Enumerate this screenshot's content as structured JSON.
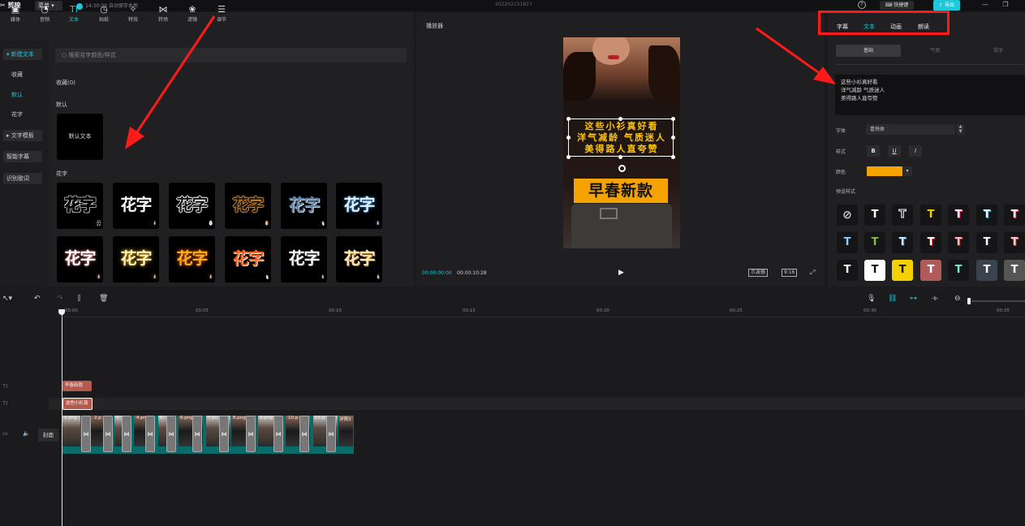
{
  "topbar": {
    "app_name": "剪映",
    "menu_label": "菜单",
    "save_status": "14:30:09 自动保存本地",
    "project_name": "202202151827",
    "shortcut_label": "快捷键",
    "export_label": "导出"
  },
  "tools": [
    {
      "label": "媒体",
      "icon": "media-icon"
    },
    {
      "label": "音频",
      "icon": "audio-icon"
    },
    {
      "label": "文本",
      "icon": "text-icon",
      "active": true
    },
    {
      "label": "贴纸",
      "icon": "sticker-icon"
    },
    {
      "label": "特效",
      "icon": "effects-icon"
    },
    {
      "label": "转场",
      "icon": "transition-icon"
    },
    {
      "label": "滤镜",
      "icon": "filter-icon"
    },
    {
      "label": "调节",
      "icon": "adjust-icon"
    }
  ],
  "sidebar": {
    "new_text": "新建文本",
    "favorites": "收藏",
    "default": "默认",
    "fancy": "花字",
    "text_template": "文字模板",
    "smart_caption": "智能字幕",
    "lyrics": "识别歌词"
  },
  "library": {
    "search_placeholder": "搜索花字颜色/样式",
    "favorites_heading": "收藏(0)",
    "default_heading": "默认",
    "default_tile": "默认文本",
    "fancy_heading": "花字",
    "fancy_sample": "花字"
  },
  "player": {
    "title": "播放器",
    "subtitle_lines": [
      "这些小衫真好看",
      "洋气减龄 气质迷人",
      "美得路人直夸赞"
    ],
    "banner": "早春新款",
    "time_current": "00:00:00:00",
    "time_total": "00:00:10:28",
    "scope_label": "示波器",
    "ratio_label": "9:16"
  },
  "inspector": {
    "tabs": [
      "字幕",
      "文本",
      "动画",
      "朗读"
    ],
    "active_tab": "文本",
    "subtabs": [
      "基础",
      "气泡",
      "花字"
    ],
    "text_value": [
      "这些小衫真好看",
      "洋气减龄 气质迷人",
      "美得路人直夸赞"
    ],
    "font_label": "字体",
    "font_value": "喜悦体",
    "style_label": "样式",
    "style_bold": "B",
    "style_underline": "U",
    "style_italic": "I",
    "color_label": "颜色",
    "color_value": "#f5a300",
    "preset_label": "预设样式",
    "preset_glyph": "T"
  },
  "timeline": {
    "ticks": [
      "00:00",
      "00:05",
      "00:10",
      "00:15",
      "00:20",
      "00:25",
      "00:30",
      "00:35"
    ],
    "text_clip_1": "早春新款",
    "text_clip_2": "这些小衫真",
    "cover_label": "封面",
    "video_clips": [
      "1.png",
      "2.p",
      "3.",
      "4.pn",
      "5.",
      "6.png",
      "7.pn",
      "8.png",
      "9.png",
      "10.p",
      "11.p",
      "详情3"
    ]
  },
  "colors": {
    "accent": "#1ec8d8",
    "highlight_red": "#ff1a1a",
    "clip_text": "#b55a4c",
    "video_track": "#0a6b6b"
  }
}
